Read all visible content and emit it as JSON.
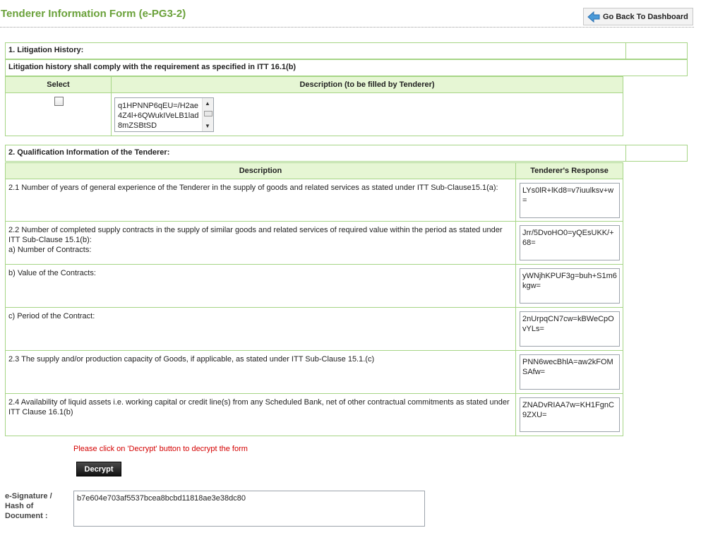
{
  "header": {
    "title": "Tenderer Information Form (e-PG3-2)",
    "back_button_label": "Go Back To Dashboard",
    "back_icon": "arrow-left-icon"
  },
  "section1": {
    "title": "1. Litigation History:",
    "note": "Litigation history shall comply with the requirement as specified in ITT 16.1(b)",
    "col_select": "Select",
    "col_description": "Description (to be filled by Tenderer)",
    "checkbox_checked": false,
    "description_value": "q1HPNNP6qEU=/H2ae4Z4l+6QWukIVeLB1lad8mZSBtSD"
  },
  "section2": {
    "title": "2. Qualification Information of the Tenderer:",
    "col_description": "Description",
    "col_response": "Tenderer's Response",
    "rows": [
      {
        "description": "2.1 Number of years of general experience of the Tenderer in the supply of goods and related services as stated under ITT Sub-Clause15.1(a):",
        "response": "LYs0lR+lKd8=v7iuulksv+w="
      },
      {
        "description": "2.2 Number of completed supply contracts in the supply of similar goods and related services of required value within the period as stated under ITT Sub-Clause 15.1(b):\na) Number of Contracts:",
        "response": "Jrr/5DvoHO0=yQEsUKK/+68="
      },
      {
        "description": "b) Value of the Contracts:",
        "response": "yWNjhKPUF3g=buh+S1m6kgw="
      },
      {
        "description": "c) Period of the Contract:",
        "response": "2nUrpqCN7cw=kBWeCpOvYLs="
      },
      {
        "description": "2.3 The supply and/or production capacity of Goods, if applicable, as stated under ITT Sub-Clause 15.1.(c)",
        "response": "PNN6wecBhlA=aw2kFOMSAfw="
      },
      {
        "description": "2.4 Availability of liquid assets i.e. working capital or credit line(s) from any Scheduled Bank, net of other contractual commitments as stated under ITT Clause 16.1(b)",
        "response": "ZNADvRIAA7w=KH1FgnC9ZXU="
      }
    ]
  },
  "footer": {
    "decrypt_note": "Please click on 'Decrypt' button to decrypt the form",
    "decrypt_label": "Decrypt",
    "signature_label": "e-Signature / Hash of Document :",
    "signature_value": "b7e604e703af5537bcea8bcbd11818ae3e38dc80"
  }
}
